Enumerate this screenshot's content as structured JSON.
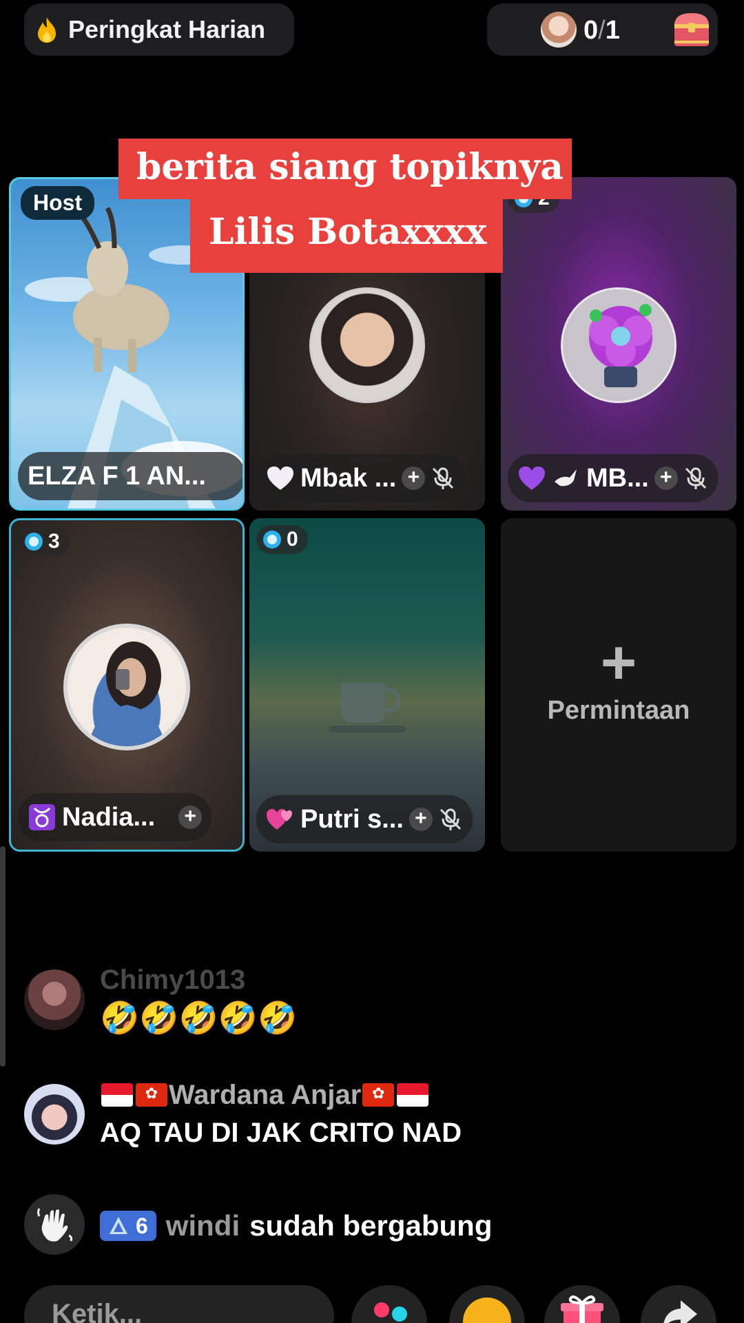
{
  "top": {
    "ranking_label": "Peringkat Harian",
    "ranking_icon": "fire-icon",
    "score_current": "0",
    "score_separator": "/",
    "score_total": "1",
    "chest_icon": "treasure-chest-icon"
  },
  "caption": {
    "line1": "berita siang topiknya",
    "line2": "Lilis Botaxxxx"
  },
  "tiles": [
    {
      "badge": "Host",
      "name": "ELZA F 1 AN...",
      "has_plus": false,
      "muted": false
    },
    {
      "badge": "",
      "name_prefix": "🤍",
      "name": "Mbak ...",
      "has_plus": true,
      "muted": true
    },
    {
      "badge_count": "2",
      "name_prefix": "💜🕊️",
      "name": "MB...",
      "has_plus": true,
      "muted": true
    },
    {
      "badge_count": "3",
      "name_prefix": "♉",
      "name": "Nadia...",
      "has_plus": true,
      "muted": false
    },
    {
      "badge_count": "0",
      "name_prefix": "💞",
      "name": "Putri s...",
      "has_plus": true,
      "muted": true
    },
    {
      "request_label": "Permintaan",
      "request_symbol": "+"
    }
  ],
  "chat": [
    {
      "user": "Chimy1013",
      "message": "🤣🤣🤣🤣🤣"
    },
    {
      "user": "Wardana Anjar",
      "message": "AQ TAU DI JAK CRITO NAD"
    }
  ],
  "join": {
    "level": "6",
    "user": "windi",
    "text": "sudah bergabung",
    "icon": "wave-hand-icon"
  },
  "bottom": {
    "comment_placeholder": "Ketik..."
  },
  "colors": {
    "caption_bg": "#e8403d",
    "host_border": "#58c9e2",
    "level_badge": "#3f6fd6",
    "gem": "#2fb0ec"
  }
}
